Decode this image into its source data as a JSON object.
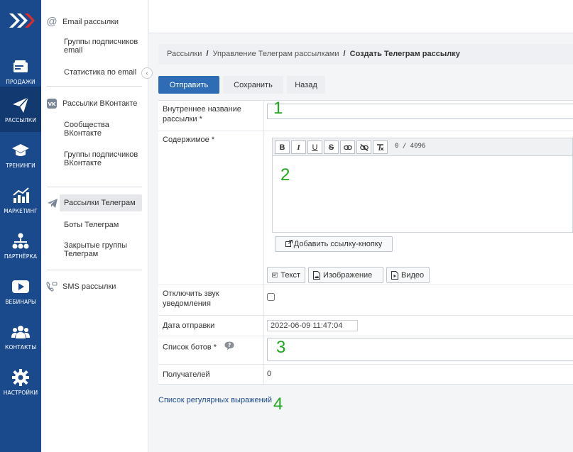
{
  "nav": {
    "items": [
      {
        "label": "ПРОДАЖИ"
      },
      {
        "label": "РАССЫЛКИ"
      },
      {
        "label": "ТРЕНИНГИ"
      },
      {
        "label": "МАРКЕТИНГ"
      },
      {
        "label": "ПАРТНЁРКА"
      },
      {
        "label": "ВЕБИНАРЫ"
      },
      {
        "label": "КОНТАКТЫ"
      },
      {
        "label": "НАСТРОЙКИ"
      }
    ]
  },
  "submenu": {
    "email_head": "Email рассылки",
    "email_groups": "Группы подписчиков email",
    "email_stats": "Статистика по email",
    "vk_head": "Рассылки ВКонтакте",
    "vk_communities": "Сообщества ВКонтакте",
    "vk_groups": "Группы подписчиков ВКонтакте",
    "tg_head": "Рассылки Телеграм",
    "tg_bots": "Боты Телеграм",
    "tg_groups": "Закрытые группы Телеграм",
    "sms_head": "SMS рассылки"
  },
  "breadcrumb": {
    "item1": "Рассылки",
    "item2": "Управление Телеграм рассылками",
    "current": "Создать Телеграм рассылку",
    "sep": "/"
  },
  "toolbar": {
    "send": "Отправить",
    "save": "Сохранить",
    "back": "Назад"
  },
  "form": {
    "internal_name_label": "Внутреннее название рассылки *",
    "internal_name_value": "",
    "content_label": "Содержимое *",
    "counter": "0 / 4096",
    "add_link_button": "Добавить ссылку-кнопку",
    "text_button": "Текст",
    "image_button": "Изображение",
    "video_button": "Видео",
    "mute_label": "Отключить звук уведомления",
    "mute_checked": false,
    "date_label": "Дата отправки",
    "date_value": "2022-06-09 11:47:04",
    "bots_label": "Список ботов *",
    "recipients_label": "Получателей",
    "recipients_value": "0"
  },
  "regex_link": "Список регулярных выражений",
  "annotations": [
    "1",
    "2",
    "3",
    "4"
  ],
  "colors": {
    "nav_bg": "#1a4a8c",
    "primary": "#2e6cb6",
    "annotation": "#1fa81f"
  }
}
